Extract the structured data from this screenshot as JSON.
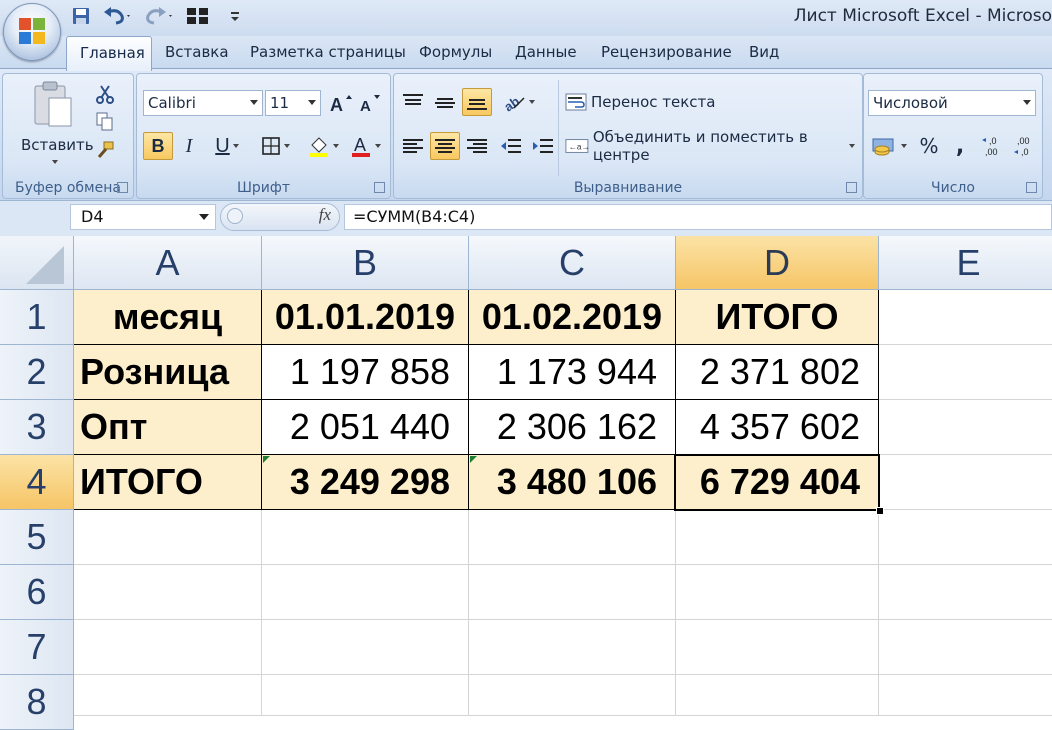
{
  "window": {
    "title": "Лист Microsoft Excel - Microso"
  },
  "quick_access": {
    "icons": [
      "save-icon",
      "undo-icon",
      "redo-icon",
      "layout-icon",
      "customize-icon"
    ]
  },
  "tabs": [
    {
      "label": "Главная",
      "active": true
    },
    {
      "label": "Вставка"
    },
    {
      "label": "Разметка страницы"
    },
    {
      "label": "Формулы"
    },
    {
      "label": "Данные"
    },
    {
      "label": "Рецензирование"
    },
    {
      "label": "Вид"
    }
  ],
  "ribbon": {
    "clipboard": {
      "label": "Буфер обмена",
      "paste_label": "Вставить"
    },
    "font": {
      "label": "Шрифт",
      "font_name": "Calibri",
      "font_size": "11",
      "bold": "B",
      "italic": "I",
      "underline": "U",
      "fill_color": "#ffff00",
      "font_color": "#e02020"
    },
    "alignment": {
      "label": "Выравнивание",
      "wrap_text": "Перенос текста",
      "merge_center": "Объединить и поместить в центре"
    },
    "number": {
      "label": "Число",
      "format": "Числовой",
      "percent": "%",
      "comma": ",",
      "inc_decimal": ",0\n,00",
      "dec_decimal": ",00\n,0"
    }
  },
  "formula_bar": {
    "name_box": "D4",
    "fx": "fx",
    "formula": "=СУММ(B4:C4)"
  },
  "sheet": {
    "columns": [
      "A",
      "B",
      "C",
      "D",
      "E"
    ],
    "selected_column": "D",
    "rows": [
      "1",
      "2",
      "3",
      "4",
      "5",
      "6",
      "7",
      "8"
    ],
    "selected_row": "4",
    "cells": {
      "A1": "месяц",
      "B1": "01.01.2019",
      "C1": "01.02.2019",
      "D1": "ИТОГО",
      "A2": "Розница",
      "B2": "1 197 858",
      "C2": "1 173 944",
      "D2": "2 371 802",
      "A3": "Опт",
      "B3": "2 051 440",
      "C3": "2 306 162",
      "D3": "4 357 602",
      "A4": "ИТОГО",
      "B4": "3 249 298",
      "C4": "3 480 106",
      "D4": "6 729 404"
    },
    "highlight_color": "#fdefcc",
    "active_cell": "D4"
  }
}
